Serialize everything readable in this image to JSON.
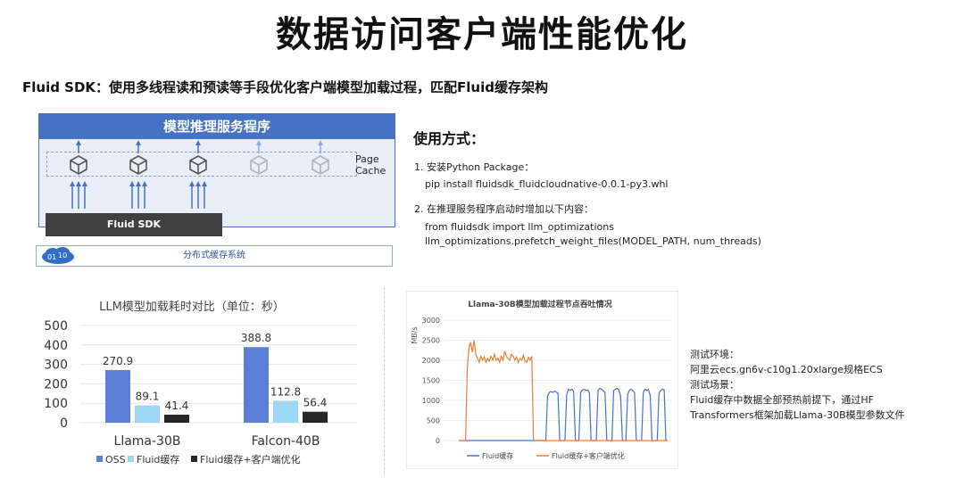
{
  "title": "数据访问客户端性能优化",
  "subtitle": "Fluid SDK：使用多线程读和预读等手段优化客户端模型加载过程，匹配Fluid缓存架构",
  "architecture": {
    "header": "模型推理服务程序",
    "page_cache": [
      "Page",
      "Cache"
    ],
    "sdk_label": "Fluid SDK",
    "distributed_cache": "分布式缓存系统",
    "colors": {
      "header": "#4472c4",
      "sdk": "#404040",
      "cube_active": "#555555",
      "cube_faded": "#b3b3b3",
      "arrow": "#4472c4"
    }
  },
  "usage": {
    "title": "使用方式：",
    "step1": "1. 安装Python Package：",
    "step1_cmd": "pip install fluidsdk_fluidcloudnative-0.0.1-py3.whl",
    "step2": "2. 在推理服务程序启动时增加以下内容：",
    "step2_line1": "from fluidsdk import llm_optimizations",
    "step2_line2": "llm_optimizations.prefetch_weight_files(MODEL_PATH, num_threads)"
  },
  "test_notes": [
    "测试环境：",
    "阿里云ecs.gn6v-c10g1.20xlarge规格ECS",
    "测试场景：",
    "Fluid缓存中数据全部预热前提下，通过HF",
    "Transformers框架加载Llama-30B模型参数文件"
  ],
  "chart_data": [
    {
      "type": "bar",
      "title": "LLM模型加载耗时对比（单位：秒）",
      "categories": [
        "Llama-30B",
        "Falcon-40B"
      ],
      "series": [
        {
          "name": "OSS",
          "values": [
            270.9,
            388.8
          ],
          "color": "#5b7fd6"
        },
        {
          "name": "Fluid缓存",
          "values": [
            89.1,
            112.8
          ],
          "color": "#9dd7f5"
        },
        {
          "name": "Fluid缓存+客户端优化",
          "values": [
            41.4,
            56.4
          ],
          "color": "#262626"
        }
      ],
      "yticks": [
        "0",
        "100",
        "200",
        "300",
        "400",
        "500"
      ],
      "ylim": [
        0,
        500
      ],
      "grid": true,
      "legend": "bottom"
    },
    {
      "type": "line",
      "title": "Llama-30B模型加载过程节点吞吐情况",
      "ylabel": "MB/s",
      "yticks": [
        "0",
        "500",
        "1000",
        "1500",
        "2000",
        "2500",
        "3000"
      ],
      "ylim": [
        0,
        3000
      ],
      "legend": "bottom",
      "series": [
        {
          "name": "Fluid缓存",
          "color": "#4472c4",
          "values": [
            0,
            0,
            0,
            0,
            0,
            0,
            0,
            0,
            0,
            0,
            0,
            0,
            0,
            0,
            0,
            0,
            0,
            0,
            0,
            0,
            0,
            0,
            0,
            0,
            0,
            0,
            0,
            0,
            0,
            0,
            0,
            0,
            0,
            0,
            0,
            0,
            0,
            0,
            0,
            0,
            0,
            0,
            0,
            0,
            0,
            0,
            0,
            0,
            0,
            0,
            0,
            1100,
            1200,
            1220,
            1200,
            1230,
            1210,
            1180,
            0,
            0,
            0,
            0,
            1150,
            1280,
            1250,
            1280,
            1220,
            0,
            0,
            0,
            1200,
            1260,
            1280,
            1250,
            1260,
            1200,
            0,
            0,
            0,
            0,
            1250,
            1300,
            1280,
            1240,
            1200,
            0,
            0,
            0,
            0,
            1250,
            1280,
            1300,
            1260,
            1100,
            0,
            0,
            0,
            1150,
            1250,
            1280,
            1240,
            1200,
            0,
            0,
            0,
            0,
            1200,
            1280,
            1250,
            1270,
            1120,
            0,
            0,
            0,
            0,
            1180,
            1250,
            1280,
            1260,
            0,
            0
          ]
        },
        {
          "name": "Fluid缓存+客户端优化",
          "color": "#ed7d31",
          "values": [
            0,
            0,
            0,
            0,
            0,
            1800,
            2300,
            2450,
            2200,
            2500,
            2150,
            2050,
            1950,
            2100,
            2000,
            2080,
            1950,
            2050,
            1980,
            2100,
            2000,
            2150,
            2000,
            2050,
            1950,
            2100,
            2000,
            2230,
            2100,
            2050,
            2000,
            2150,
            2100,
            2000,
            2080,
            1950,
            2050,
            2000,
            2130,
            1980,
            1950,
            2070,
            2000,
            2100,
            0,
            0,
            0,
            0,
            0,
            0,
            0,
            0,
            0,
            0,
            0,
            0,
            0,
            0,
            0,
            0,
            0,
            0,
            0,
            0,
            0,
            0,
            0,
            0,
            0,
            0,
            0,
            0,
            0,
            0,
            0,
            0,
            0,
            0,
            0,
            0,
            0,
            0,
            0,
            0,
            0,
            0,
            0,
            0,
            0,
            0,
            0,
            0,
            0,
            0,
            0,
            0,
            0,
            0,
            0,
            0,
            0,
            0,
            0,
            0,
            0,
            0,
            0,
            0,
            0,
            0,
            0,
            0,
            0,
            0,
            0,
            0,
            0,
            0,
            0,
            0,
            0,
            0,
            0,
            0
          ]
        }
      ]
    }
  ]
}
